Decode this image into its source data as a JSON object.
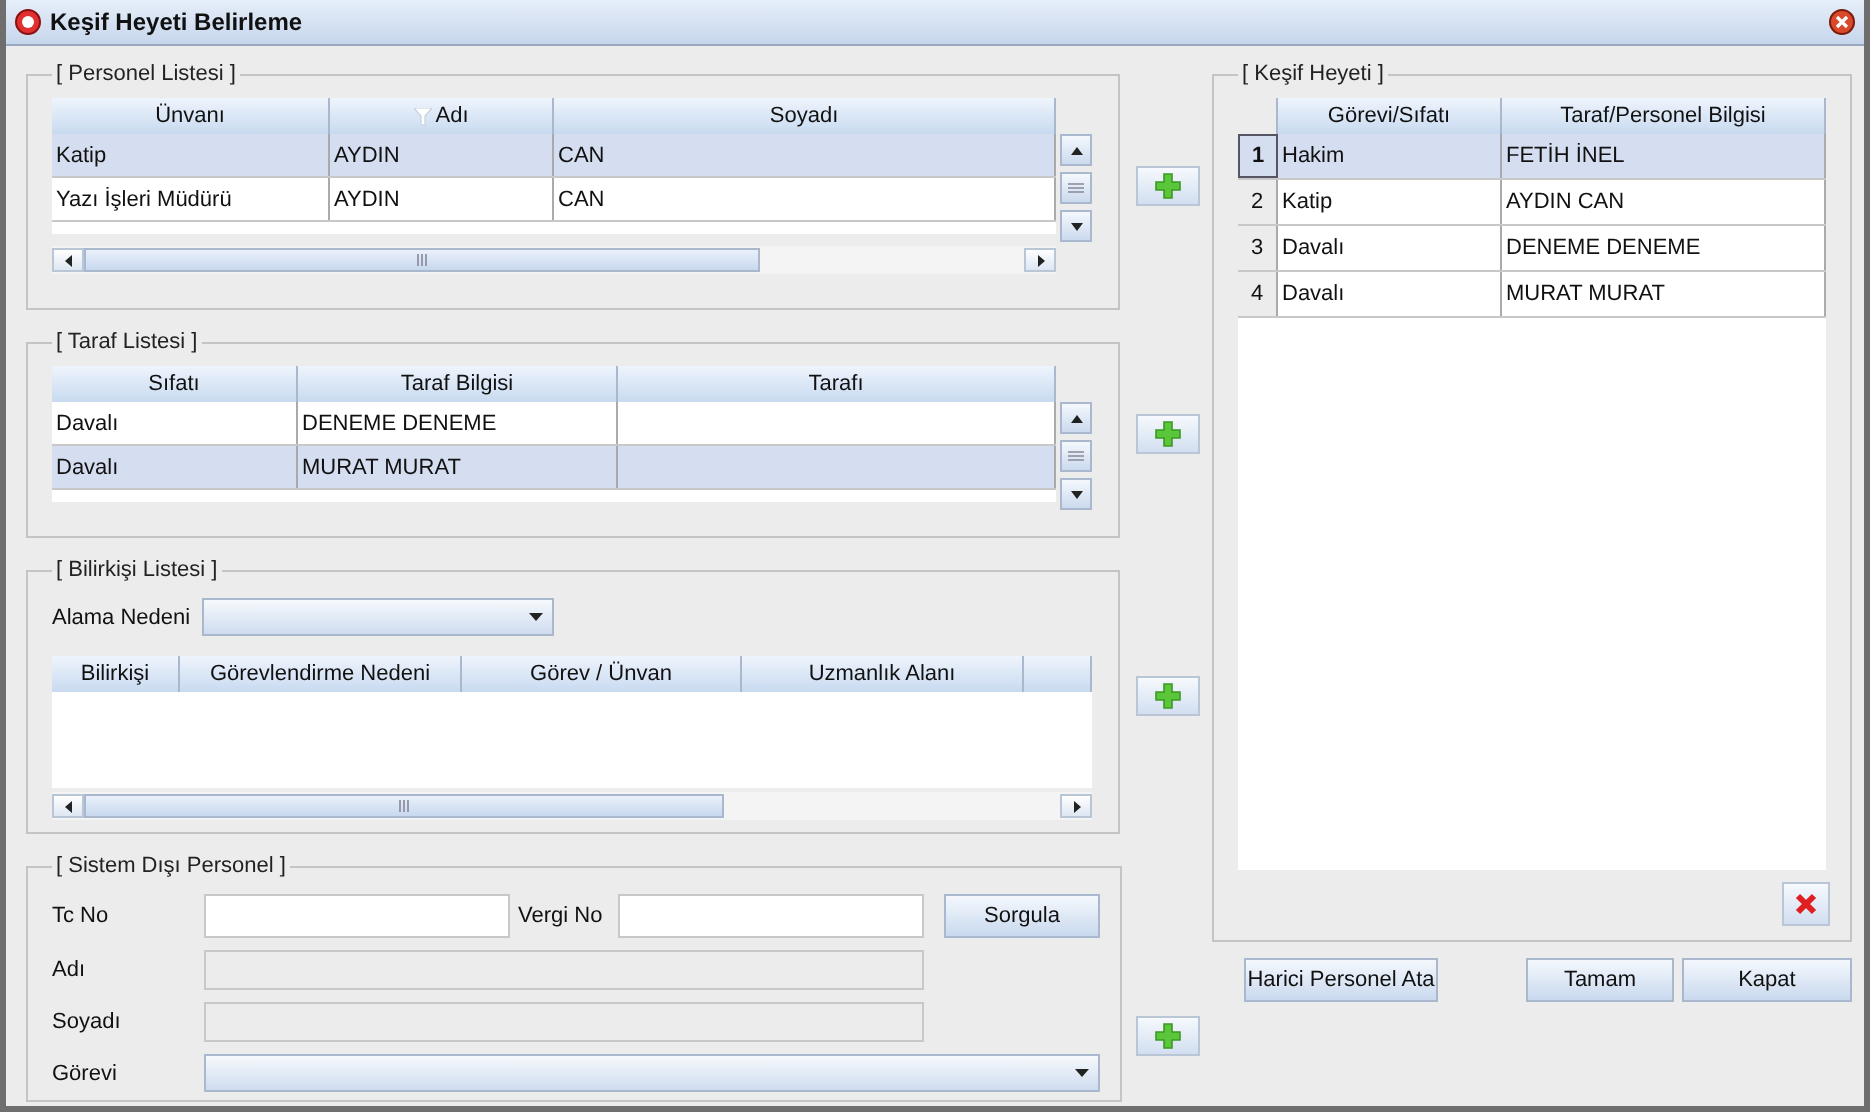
{
  "window": {
    "title": "Keşif Heyeti Belirleme"
  },
  "personel": {
    "legend": "[ Personel Listesi ]",
    "columns": [
      "Ünvanı",
      "Adı",
      "Soyadı"
    ],
    "rows": [
      {
        "cells": [
          "Katip",
          "AYDIN",
          "CAN"
        ],
        "selected": true
      },
      {
        "cells": [
          "Yazı İşleri Müdürü",
          "AYDIN",
          "CAN"
        ],
        "selected": false
      }
    ]
  },
  "taraf": {
    "legend": "[ Taraf Listesi ]",
    "columns": [
      "Sıfatı",
      "Taraf Bilgisi",
      "Tarafı"
    ],
    "rows": [
      {
        "cells": [
          "Davalı",
          "DENEME DENEME",
          ""
        ],
        "selected": false
      },
      {
        "cells": [
          "Davalı",
          "MURAT MURAT",
          ""
        ],
        "selected": true
      }
    ]
  },
  "bilirkisi": {
    "legend": "[ Bilirkişi Listesi ]",
    "reason_label": "Alama Nedeni",
    "columns": [
      "Bilirkişi",
      "Görevlendirme Nedeni",
      "Görev / Ünvan",
      "Uzmanlık Alanı"
    ]
  },
  "sistem_disi": {
    "legend": "[ Sistem Dışı Personel ]",
    "tc_label": "Tc No",
    "vergi_label": "Vergi No",
    "query_button": "Sorgula",
    "name_label": "Adı",
    "surname_label": "Soyadı",
    "name_disabled": true,
    "role_label": "Görevi"
  },
  "kesif": {
    "legend": "[ Keşif Heyeti ]",
    "columns": [
      "Görevi/Sıfatı",
      "Taraf/Personel Bilgisi"
    ],
    "rows": [
      {
        "number": "1",
        "cells": [
          "Hakim",
          "FETİH İNEL"
        ],
        "selected": true
      },
      {
        "number": "2",
        "cells": [
          "Katip",
          "AYDIN CAN"
        ],
        "selected": false
      },
      {
        "number": "3",
        "cells": [
          "Davalı",
          "DENEME DENEME"
        ],
        "selected": false
      },
      {
        "number": "4",
        "cells": [
          "Davalı",
          "MURAT MURAT"
        ],
        "selected": false
      }
    ]
  },
  "buttons": [
    "Harici Personel Ata",
    "Tamam",
    "Kapat"
  ]
}
